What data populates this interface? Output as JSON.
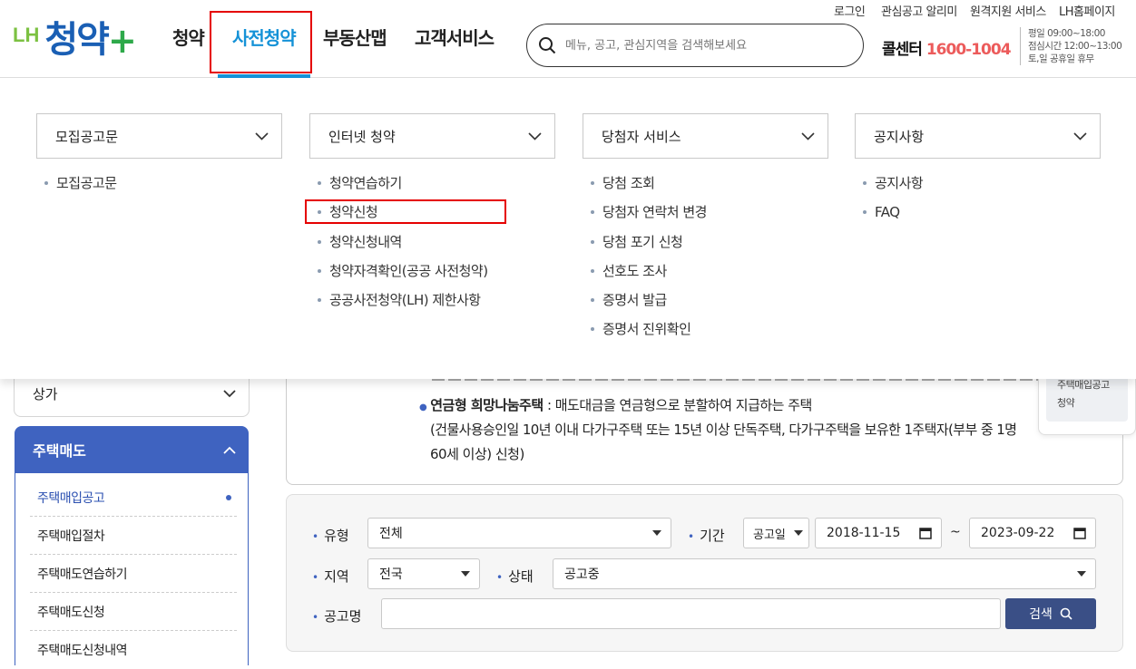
{
  "header": {
    "logo": {
      "lh": "LH",
      "main": "청약",
      "plus": "+"
    },
    "gnb": [
      "청약",
      "사전청약",
      "부동산맵",
      "고객서비스"
    ],
    "util_links": [
      "로그인",
      "관심공고 알리미",
      "원격지원 서비스",
      "LH홈페이지"
    ],
    "search_placeholder": "메뉴, 공고, 관심지역을 검색해보세요",
    "call_center": {
      "label": "콜센터",
      "number": "1600-1004"
    },
    "hours": [
      "평일 09:00~18:00",
      "점심시간 12:00~13:00",
      "토,일 공휴일 휴무"
    ]
  },
  "mega_menu": {
    "columns": [
      {
        "title": "모집공고문",
        "items": [
          "모집공고문"
        ]
      },
      {
        "title": "인터넷 청약",
        "items": [
          "청약연습하기",
          "청약신청",
          "청약신청내역",
          "청약자격확인(공공 사전청약)",
          "공공사전청약(LH) 제한사항"
        ]
      },
      {
        "title": "당첨자 서비스",
        "items": [
          "당첨 조회",
          "당첨자 연락처 변경",
          "당첨 포기 신청",
          "선호도 조사",
          "증명서 발급",
          "증명서 진위확인"
        ]
      },
      {
        "title": "공지사항",
        "items": [
          "공지사항",
          "FAQ"
        ]
      }
    ]
  },
  "sidebar": {
    "sanga": "상가",
    "section_title": "주택매도",
    "items": [
      "주택매입공고",
      "주택매입절차",
      "주택매도연습하기",
      "주택매도신청",
      "주택매도신청내역"
    ]
  },
  "content": {
    "bullet_title": "연금형 희망나눔주택",
    "bullet_desc": " : 매도대금을 연금형으로 분할하여 지급하는 주택",
    "line2": "(건물사용승인일 10년 이내 다가구주택 또는 15년 이상 단독주택, 다가구주택을 보유한 1주택자(부부 중 1명",
    "line3": "60세 이상) 신청)"
  },
  "quick": {
    "line1": "주택매입공고",
    "line2": "청약"
  },
  "filter": {
    "type_label": "유형",
    "type_value": "전체",
    "period_label": "기간",
    "period_kind": "공고일",
    "date_from": "2018-11-15",
    "tilde": "~",
    "date_to": "2023-09-22",
    "region_label": "지역",
    "region_value": "전국",
    "status_label": "상태",
    "status_value": "공고중",
    "name_label": "공고명",
    "search_button": "검색"
  },
  "colors": {
    "brand_blue": "#1592d7",
    "lnb_blue": "#3f63c0",
    "highlight_red": "#e50000",
    "call_red": "#ec5b5b"
  }
}
